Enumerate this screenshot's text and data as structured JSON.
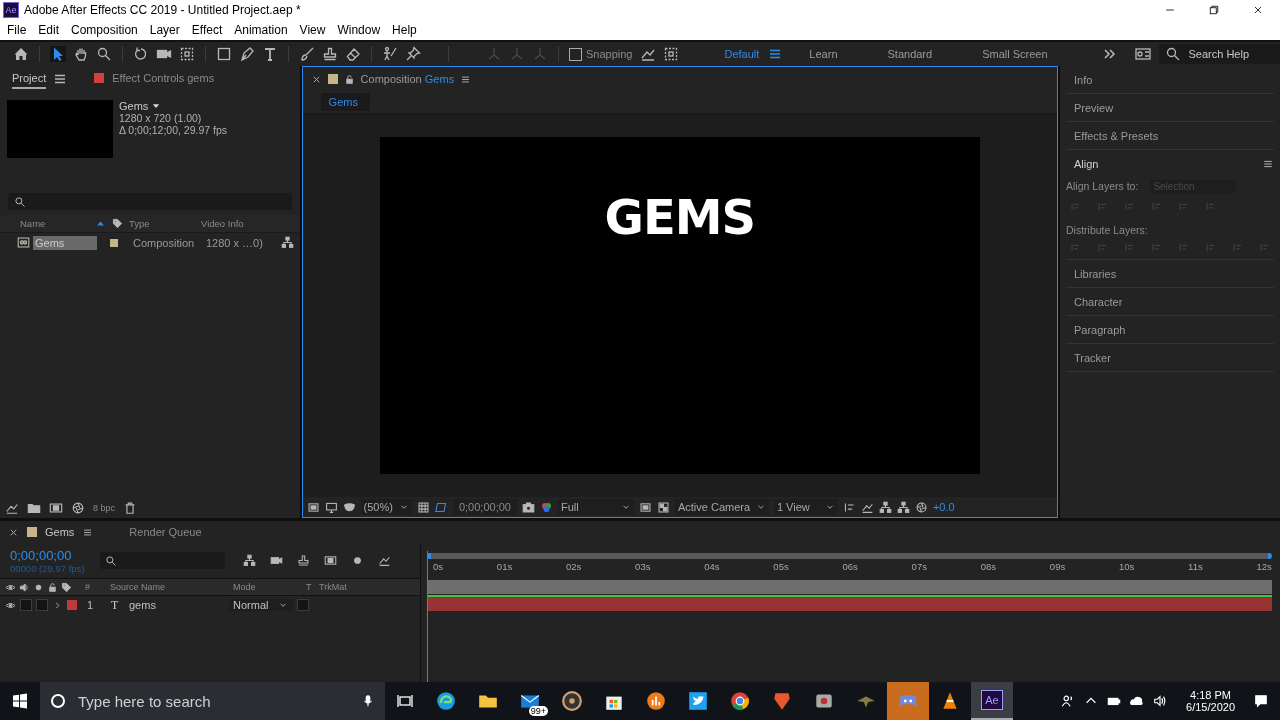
{
  "window": {
    "app_badge": "Ae",
    "title": "Adobe After Effects CC 2019 - Untitled Project.aep *"
  },
  "menu": [
    "File",
    "Edit",
    "Composition",
    "Layer",
    "Effect",
    "Animation",
    "View",
    "Window",
    "Help"
  ],
  "toolbar": {
    "snapping": {
      "label": "Snapping",
      "checked": false
    },
    "workspaces": [
      {
        "label": "Default",
        "selected": true
      },
      {
        "label": "Learn",
        "selected": false
      },
      {
        "label": "Standard",
        "selected": false
      },
      {
        "label": "Small Screen",
        "selected": false
      }
    ],
    "search": {
      "placeholder": "Search Help"
    }
  },
  "project_panel": {
    "tabs": [
      {
        "label": "Project",
        "selected": true
      },
      {
        "label": "Effect Controls gems",
        "selected": false,
        "color": "#d04040"
      }
    ],
    "preview": {
      "name": "Gems",
      "size": "1280 x 720 (1.00)",
      "duration": "Δ 0;00;12;00, 29.97 fps"
    },
    "columns": [
      "Name",
      "Type",
      "Video Info"
    ],
    "rows": [
      {
        "name": "Gems",
        "type": "Composition",
        "video_info": "1280 x …0)",
        "color": "#c8b48a",
        "selected": true
      }
    ],
    "bpc": "8 bpc"
  },
  "composition_panel": {
    "tab": {
      "label": "Composition",
      "name": "Gems",
      "color": "#c8b48a"
    },
    "breadcrumb": "Gems",
    "canvas_text": "GEMS",
    "zoom": "(50%)",
    "timecode": "0;00;00;00",
    "resolution": "Full",
    "camera": "Active Camera",
    "views": "1 View",
    "exposure": "+0.0"
  },
  "right_panel": {
    "panels": [
      {
        "label": "Info",
        "expanded": false
      },
      {
        "label": "Preview",
        "expanded": false
      },
      {
        "label": "Effects & Presets",
        "expanded": false
      },
      {
        "label": "Align",
        "expanded": true,
        "align_to_label": "Align Layers to:",
        "align_to": "Selection",
        "distribute_label": "Distribute Layers:"
      },
      {
        "label": "Libraries",
        "expanded": false
      },
      {
        "label": "Character",
        "expanded": false
      },
      {
        "label": "Paragraph",
        "expanded": false
      },
      {
        "label": "Tracker",
        "expanded": false
      }
    ]
  },
  "timeline": {
    "tabs": [
      {
        "label": "Gems",
        "selected": true,
        "color": "#c8b48a"
      },
      {
        "label": "Render Queue",
        "selected": false
      }
    ],
    "timecode": "0;00;00;00",
    "frame_info": "00000 (29.97 fps)",
    "columns": [
      "#",
      "Source Name",
      "Mode",
      "T",
      "TrkMat"
    ],
    "ruler": [
      "0s",
      "01s",
      "02s",
      "03s",
      "04s",
      "05s",
      "06s",
      "07s",
      "08s",
      "09s",
      "10s",
      "11s",
      "12s"
    ],
    "layers": [
      {
        "number": "1",
        "type_glyph": "T",
        "name": "gems",
        "mode": "Normal",
        "color": "#c0393b"
      }
    ]
  },
  "taskbar": {
    "search_placeholder": "Type here to search",
    "mail_badge": "99+",
    "ae_label": "Ae",
    "time": "4:18 PM",
    "date": "6/15/2020"
  }
}
